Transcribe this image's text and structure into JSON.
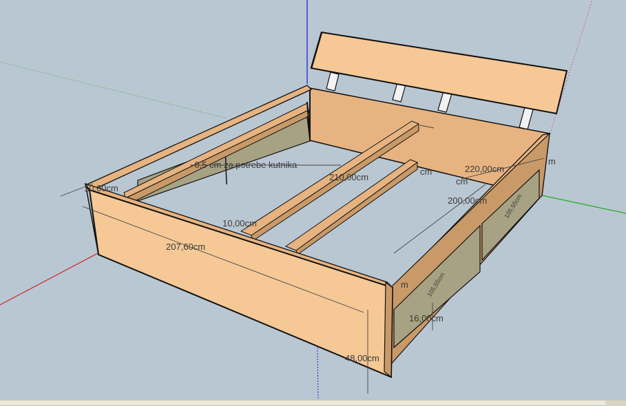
{
  "dimensions": {
    "note": "-0,5 cm za potrebe kutnika",
    "length_outer": "207,60cm",
    "height": "48,00cm",
    "rail_width": "10,00cm",
    "board_thickness": "10,00cm",
    "slat_length": "210,00cm",
    "width_outer": "220,00cm",
    "width_inner": "200,00cm",
    "drawer_height": "16,00cm",
    "drawer_label_1": "105,55cm",
    "drawer_label_2": "105,55cm",
    "cut_label_1": "cm",
    "cut_label_2": "m",
    "cut_label_3": "m",
    "cut_label_4": "cm"
  },
  "colors": {
    "background": "#b9c7d2",
    "wood_light": "#f5c896",
    "wood_mid": "#e6b381",
    "wood_dark": "#c99a68",
    "drawer_olive": "#a6a283",
    "axis_blue": "#2222dd",
    "axis_red": "#cc2222",
    "axis_green": "#22aa22"
  }
}
